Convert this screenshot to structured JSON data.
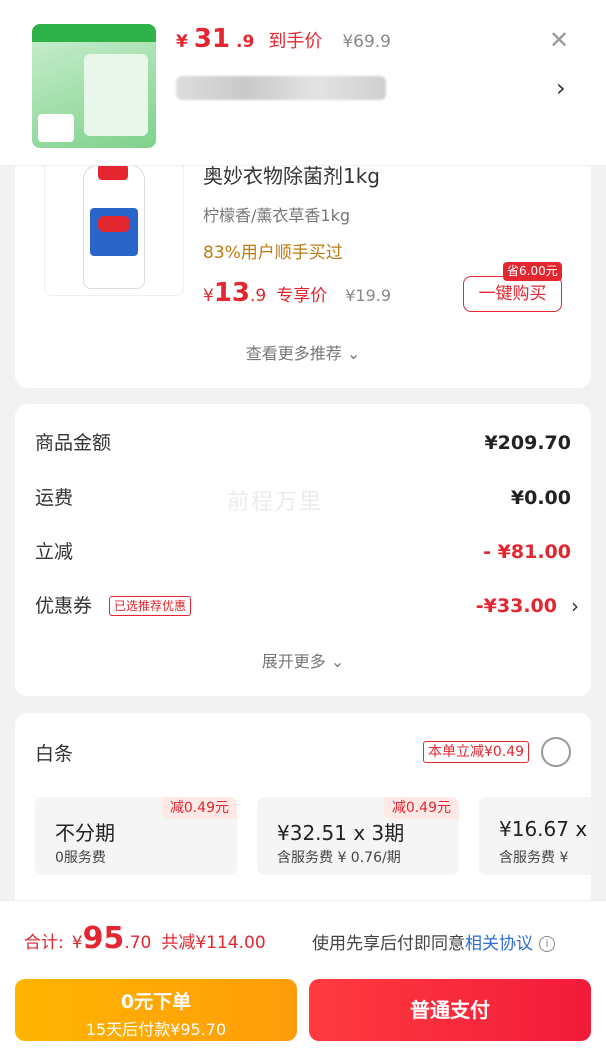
{
  "header": {
    "price_symbol": "¥",
    "price_int": "31",
    "price_dec": ".9",
    "price_tag": "到手价",
    "original_price": "¥69.9"
  },
  "recommendation": {
    "title": "奥妙衣物除菌剂1kg",
    "spec": "柠檬香/薰衣草香1kg",
    "bought": "83%用户顺手买过",
    "price_symbol": "¥",
    "price_int": "13",
    "price_dec": ".9",
    "price_tag": "专享价",
    "original_price": "¥19.9",
    "save_badge": "省6.00元",
    "buy_button": "一键购买",
    "more_label": "查看更多推荐 ⌄"
  },
  "amounts": {
    "goods_label": "商品金额",
    "goods_value": "¥209.70",
    "shipping_label": "运费",
    "shipping_value": "¥0.00",
    "discount_label": "立减",
    "discount_value": "- ¥81.00",
    "coupon_label": "优惠券",
    "coupon_tag": "已选推荐优惠",
    "coupon_value": "-¥33.00",
    "watermark": "前程万里",
    "expand_label": "展开更多 ⌄"
  },
  "baitiao": {
    "title": "白条",
    "discount_tag": "本单立减¥0.49",
    "plans": [
      {
        "tag": "减0.49元",
        "title": "不分期",
        "sub": "0服务费"
      },
      {
        "tag": "减0.49元",
        "title": "¥32.51 x 3期",
        "sub": "含服务费 ¥ 0.76/期"
      },
      {
        "tag": "",
        "title": "¥16.67 x",
        "sub": "含服务费 ¥"
      }
    ]
  },
  "footer": {
    "total_label": "合计:",
    "total_symbol": "¥",
    "total_int": "95",
    "total_dec": ".70",
    "total_saved": "共减¥114.00",
    "agree_text": "使用先享后付即同意",
    "agree_link": "相关协议",
    "pay_later_line1": "0元下单",
    "pay_later_line2": "15天后付款¥95.70",
    "pay_now": "普通支付"
  },
  "colors": {
    "accent_red": "#e3262f",
    "pay_later_orange": "#ffa800",
    "link_blue": "#2e6ed6"
  }
}
